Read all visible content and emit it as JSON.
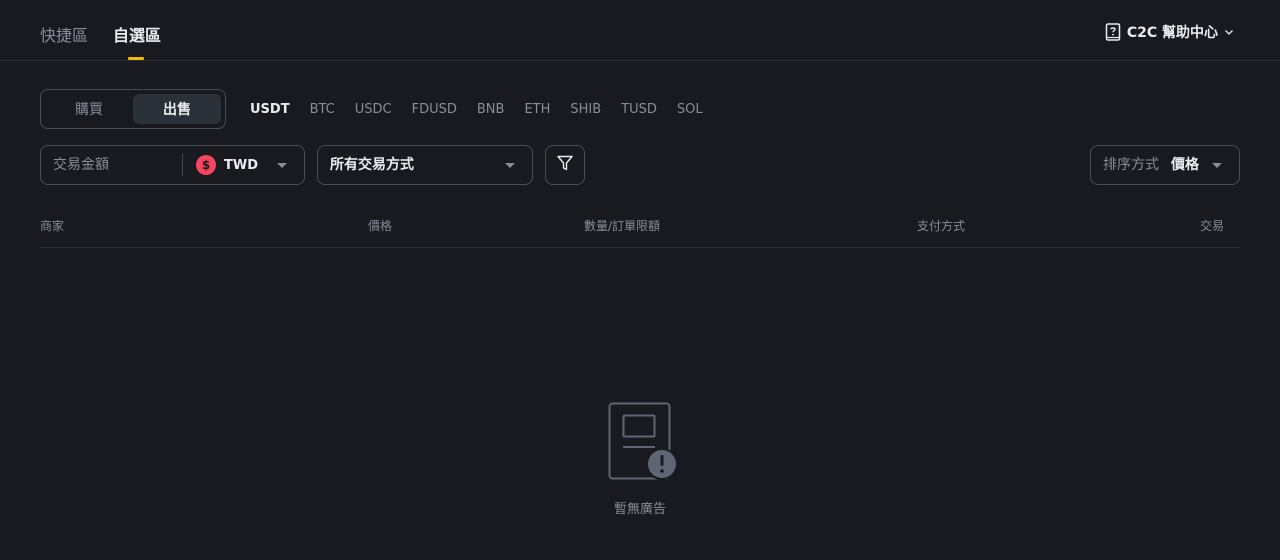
{
  "header": {
    "tabs": [
      {
        "label": "快捷區"
      },
      {
        "label": "自選區"
      }
    ],
    "help_label": "C2C 幫助中心"
  },
  "trade_side": {
    "buy_label": "購買",
    "sell_label": "出售"
  },
  "cryptos": [
    "USDT",
    "BTC",
    "USDC",
    "FDUSD",
    "BNB",
    "ETH",
    "SHIB",
    "TUSD",
    "SOL"
  ],
  "filters": {
    "amount_placeholder": "交易金額",
    "currency_symbol": "$",
    "currency": "TWD",
    "payment_method": "所有交易方式",
    "sort_label": "排序方式",
    "sort_value": "價格"
  },
  "table": {
    "columns": [
      "商家",
      "價格",
      "數量/訂單限額",
      "支付方式",
      "交易"
    ]
  },
  "empty_state": {
    "message": "暫無廣告"
  },
  "colors": {
    "background": "#181a20",
    "accent": "#f0b90b",
    "border": "#474d57",
    "muted_text": "#848e9c",
    "primary_text": "#eaecef",
    "currency_badge": "#f6465d"
  }
}
